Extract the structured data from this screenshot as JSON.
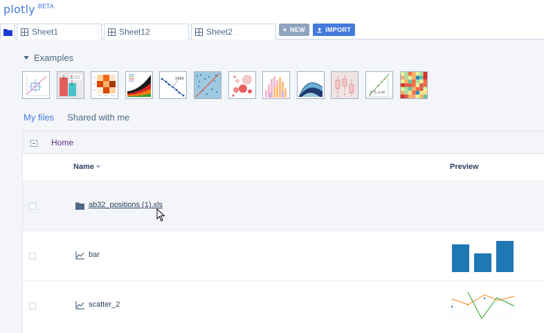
{
  "header": {
    "brand": "plotly",
    "badge": "BETA"
  },
  "tabs": {
    "folder_icon": "folder-icon",
    "sheets": [
      {
        "label": "Sheet1"
      },
      {
        "label": "Sheet12"
      },
      {
        "label": "Sheet2"
      }
    ],
    "new_label": "NEW",
    "import_label": "IMPORT"
  },
  "examples": {
    "label": "Examples",
    "thumbnails": [
      {
        "name": "example-error-bars"
      },
      {
        "name": "example-bar-legend"
      },
      {
        "name": "example-heatmap-grid"
      },
      {
        "name": "example-stacked-area"
      },
      {
        "name": "example-line-annotation",
        "annotation": "1990"
      },
      {
        "name": "example-scatter-diagonal"
      },
      {
        "name": "example-bubbles"
      },
      {
        "name": "example-histograms"
      },
      {
        "name": "example-filled-area"
      },
      {
        "name": "example-box-plot"
      },
      {
        "name": "example-fit-curve",
        "annotation": "R^2=0.99"
      },
      {
        "name": "example-color-matrix"
      }
    ]
  },
  "files": {
    "tabs": [
      {
        "label": "My files",
        "active": true
      },
      {
        "label": "Shared with me",
        "active": false
      }
    ],
    "breadcrumb": "Home",
    "columns": {
      "name": "Name",
      "preview": "Preview"
    },
    "rows": [
      {
        "name": "ab32_positions (1).xls",
        "type": "folder",
        "icon": "folder-icon"
      },
      {
        "name": "bar",
        "type": "plot",
        "icon": "line-chart-icon",
        "preview": "bar"
      },
      {
        "name": "scatter_2",
        "type": "plot",
        "icon": "line-chart-icon",
        "preview": "scatter"
      }
    ]
  },
  "colors": {
    "accent": "#447adb",
    "crumb": "#5b2a86",
    "bar": "#1f77b4",
    "orange": "#ff7f0e",
    "green": "#2ca02c"
  }
}
